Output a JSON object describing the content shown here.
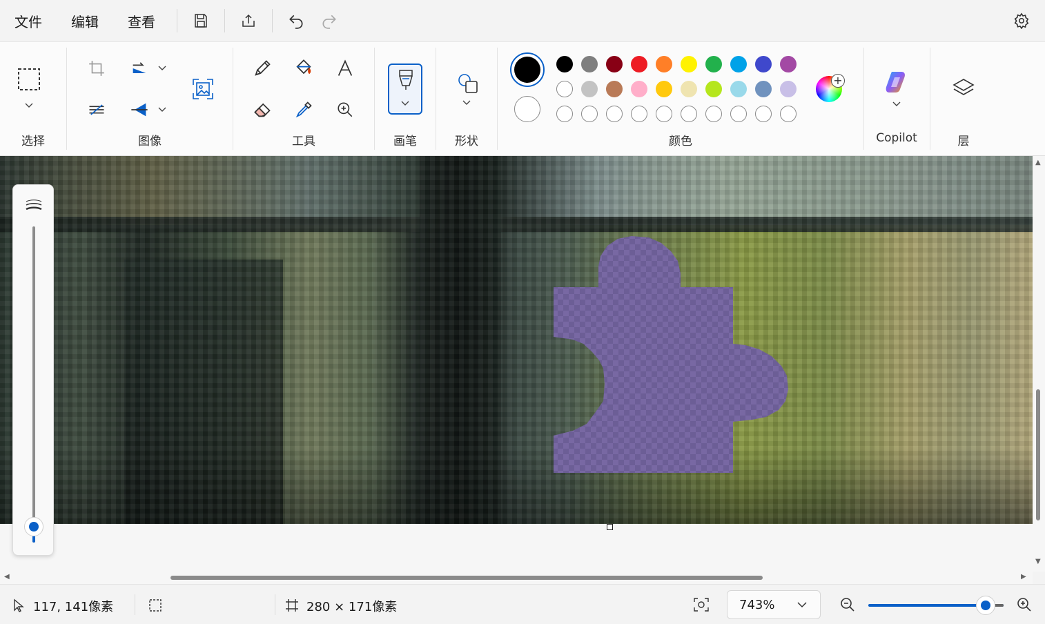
{
  "menubar": {
    "file": "文件",
    "edit": "编辑",
    "view": "查看"
  },
  "ribbon": {
    "groups": {
      "select": "选择",
      "image": "图像",
      "tools": "工具",
      "brushes": "画笔",
      "shapes": "形状",
      "colors": "颜色",
      "copilot": "Copilot",
      "layers": "层"
    },
    "colors": {
      "primary": "#000000",
      "secondary": "#ffffff",
      "palette_row1": [
        "#000000",
        "#7f7f7f",
        "#880015",
        "#ed1c24",
        "#ff7f27",
        "#fff200",
        "#22b14c",
        "#00a2e8",
        "#3f48cc",
        "#a349a4"
      ],
      "palette_row2": [
        "#ffffff",
        "#c3c3c3",
        "#b97a57",
        "#ffaec9",
        "#ffc90e",
        "#efe4b0",
        "#b5e61d",
        "#99d9ea",
        "#7092be",
        "#c8bfe7"
      ],
      "custom_slots": 10
    }
  },
  "canvas": {
    "selection_fill": "#6e5f99"
  },
  "statusbar": {
    "cursor_position": "117, 141像素",
    "canvas_size": "280 × 171像素",
    "zoom": "743%"
  }
}
